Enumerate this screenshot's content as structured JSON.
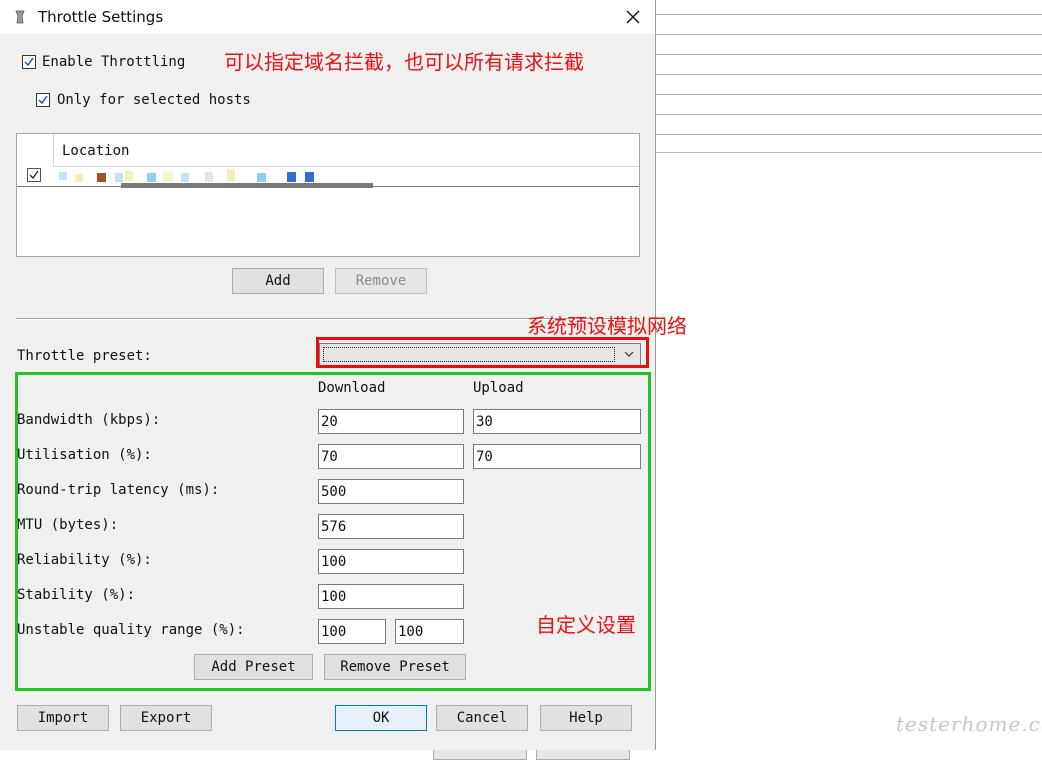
{
  "window": {
    "title": "Throttle Settings",
    "icon": "throttle-app-icon"
  },
  "options": {
    "enable_throttling": {
      "label": "Enable Throttling",
      "checked": true
    },
    "only_selected_hosts": {
      "label": "Only for selected hosts",
      "checked": true
    }
  },
  "hosts": {
    "columns": [
      "Location"
    ],
    "rows": [
      {
        "checked": true,
        "location": ""
      }
    ],
    "add_label": "Add",
    "remove_label": "Remove"
  },
  "preset": {
    "label": "Throttle preset:",
    "selected": ""
  },
  "columns": {
    "download": "Download",
    "upload": "Upload"
  },
  "fields": {
    "bandwidth": {
      "label": "Bandwidth (kbps):",
      "download": "20",
      "upload": "30"
    },
    "utilisation": {
      "label": "Utilisation (%):",
      "download": "70",
      "upload": "70"
    },
    "latency": {
      "label": "Round-trip latency (ms):",
      "value": "500"
    },
    "mtu": {
      "label": "MTU (bytes):",
      "value": "576"
    },
    "reliability": {
      "label": "Reliability (%):",
      "value": "100"
    },
    "stability": {
      "label": "Stability (%):",
      "value": "100"
    },
    "unstable_range": {
      "label": "Unstable quality range (%):",
      "min": "100",
      "max": "100"
    }
  },
  "preset_buttons": {
    "add": "Add Preset",
    "remove": "Remove Preset"
  },
  "footer": {
    "import": "Import",
    "export": "Export",
    "ok": "OK",
    "cancel": "Cancel",
    "help": "Help"
  },
  "annotations": {
    "hosts_note": "可以指定域名拦截，也可以所有请求拦截",
    "preset_note": "系统预设模拟网络",
    "custom_note": "自定义设置",
    "red_color": "#f00a0a",
    "green_color": "#22c422"
  },
  "watermark": "testerhome.com"
}
